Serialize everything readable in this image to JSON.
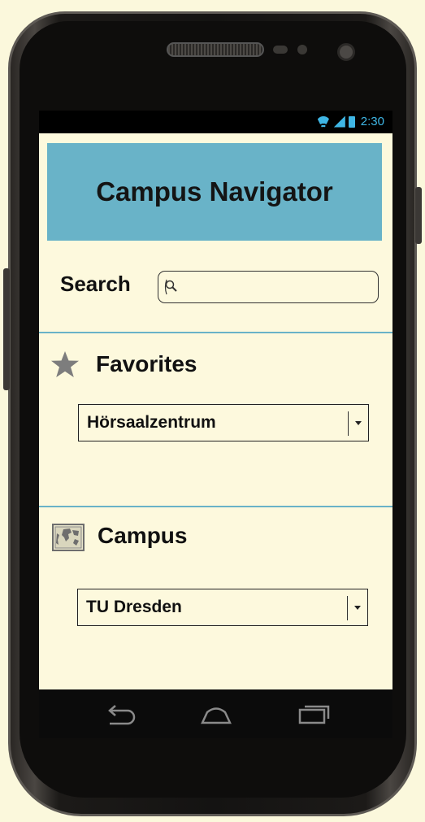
{
  "status_bar": {
    "time": "2:30",
    "icons": [
      "wifi-icon",
      "signal-icon",
      "battery-icon"
    ]
  },
  "header": {
    "title": "Campus Navigator",
    "background_color": "#69b3c8"
  },
  "search": {
    "label": "Search",
    "value": "",
    "placeholder": ""
  },
  "favorites": {
    "title": "Favorites",
    "icon": "star-icon",
    "selected": "Hörsaalzentrum"
  },
  "campus": {
    "title": "Campus",
    "icon": "map-icon",
    "selected": "TU Dresden"
  },
  "nav_bar": {
    "buttons": [
      "back-icon",
      "home-icon",
      "recent-apps-icon"
    ]
  },
  "colors": {
    "screen_background": "#fdf9dd",
    "accent_divider": "#69b3c8",
    "status_text": "#3fb6e5"
  }
}
